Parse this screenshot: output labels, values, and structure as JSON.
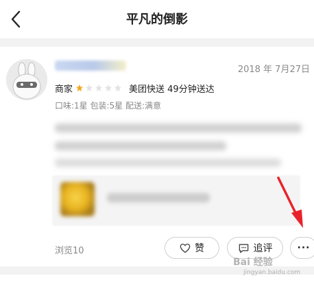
{
  "header": {
    "title": "平凡的倒影",
    "back_icon": "chevron-left-icon"
  },
  "review": {
    "date": "2018 年 7月27日",
    "merchant_label": "商家",
    "star_rating": 1,
    "star_max": 5,
    "star_color": "#f5a623",
    "delivery_text": "美团快送 49分钟送达",
    "sub_ratings": "口味:1星 包装:5星 配送:满意",
    "views": "浏览10"
  },
  "actions": {
    "like_label": "赞",
    "reply_label": "追评",
    "more_label": "···"
  },
  "annotation": {
    "arrow_color": "#e8232b"
  },
  "watermark": {
    "brand": "Bai 经验",
    "url": "jingyan.baidu.com"
  }
}
